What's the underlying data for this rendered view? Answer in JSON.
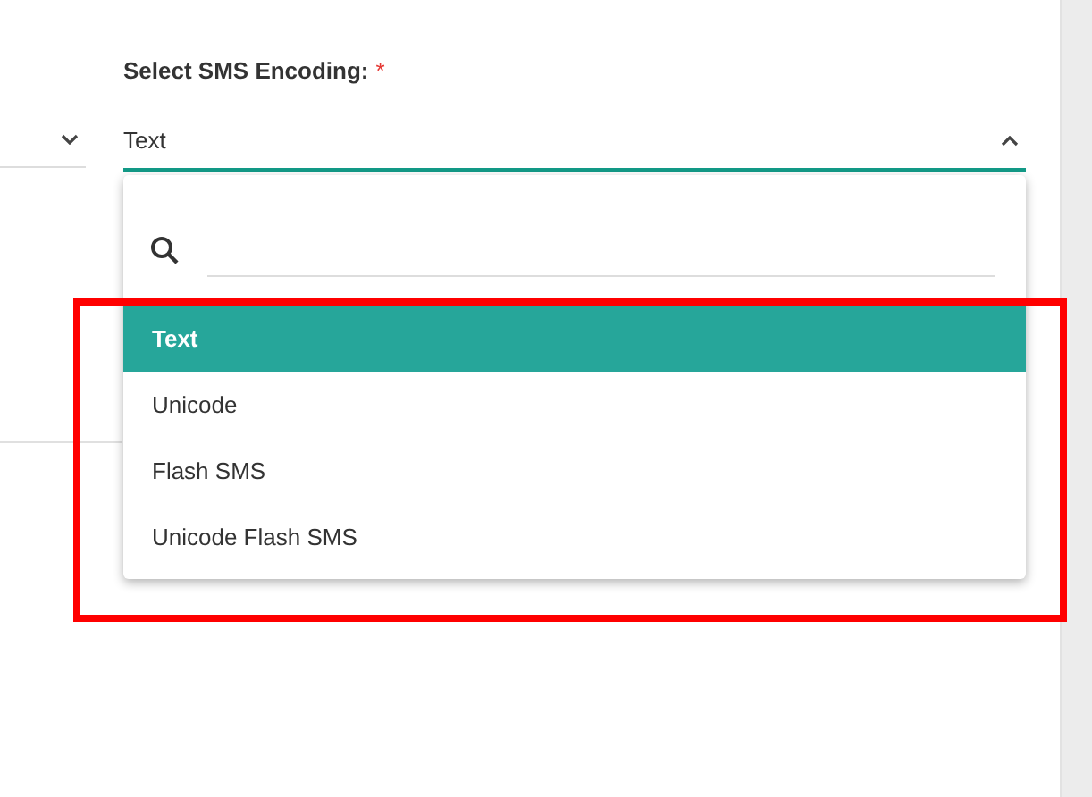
{
  "encoding_field": {
    "label": "Select SMS Encoding:",
    "required_mark": "*",
    "value": "Text",
    "expanded": true
  },
  "options": [
    {
      "label": "Text",
      "selected": true
    },
    {
      "label": "Unicode",
      "selected": false
    },
    {
      "label": "Flash SMS",
      "selected": false
    },
    {
      "label": "Unicode Flash SMS",
      "selected": false
    }
  ]
}
